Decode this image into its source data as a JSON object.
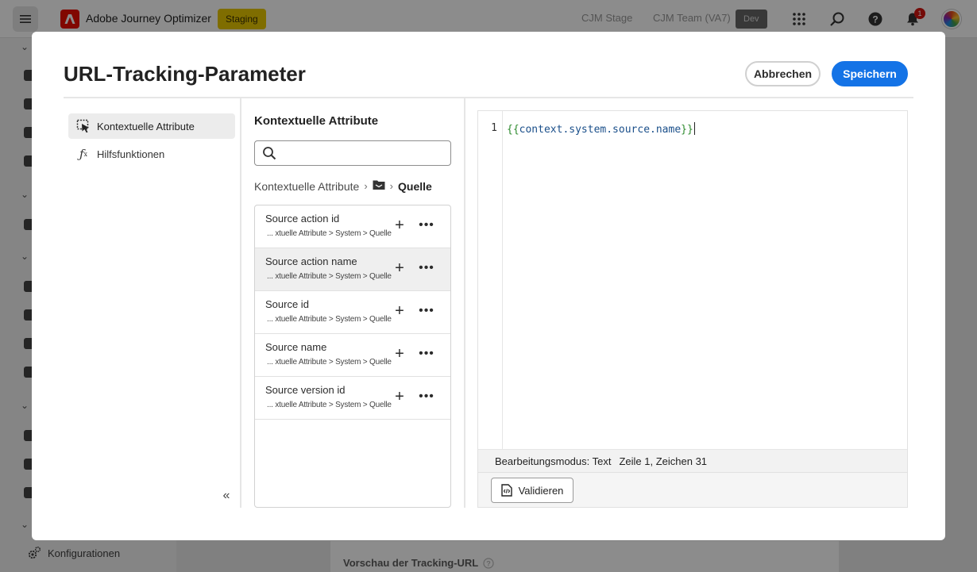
{
  "app": {
    "name": "Adobe Journey Optimizer",
    "environment": "Staging",
    "org_stage": "CJM Stage",
    "org_team": "CJM Team (VA7)",
    "org_badge": "Dev",
    "notification_count": "1",
    "brand_color": "#eb1000"
  },
  "sidenav": {
    "config_label": "Konfigurationen"
  },
  "background": {
    "card_label": "Vorschau der Tracking-URL"
  },
  "modal": {
    "title": "URL-Tracking-Parameter",
    "cancel_label": "Abbrechen",
    "save_label": "Speichern",
    "primary_color": "#1473e6"
  },
  "rail": {
    "items": [
      {
        "label": "Kontextuelle Attribute",
        "icon": "cursor-select-icon",
        "active": true
      },
      {
        "label": "Hilfsfunktionen",
        "icon": "function-icon",
        "active": false
      }
    ]
  },
  "attributes": {
    "title": "Kontextuelle Attribute",
    "search_value": "",
    "breadcrumb": {
      "root": "Kontextuelle Attribute",
      "middle_icon": "folder-icon",
      "current": "Quelle"
    },
    "items": [
      {
        "name": "Source action id",
        "path": "... xtuelle Attribute > System > Quelle"
      },
      {
        "name": "Source action name",
        "path": "... xtuelle Attribute > System > Quelle"
      },
      {
        "name": "Source id",
        "path": "... xtuelle Attribute > System > Quelle"
      },
      {
        "name": "Source name",
        "path": "... xtuelle Attribute > System > Quelle"
      },
      {
        "name": "Source version id",
        "path": "... xtuelle Attribute > System > Quelle"
      }
    ]
  },
  "editor": {
    "line_number": "1",
    "code_open": "{{",
    "code_expr": "context.system.source.name",
    "code_close": "}}",
    "mode": "Bearbeitungsmodus: Text",
    "position": "Zeile 1, Zeichen 31",
    "validate_label": "Validieren"
  }
}
